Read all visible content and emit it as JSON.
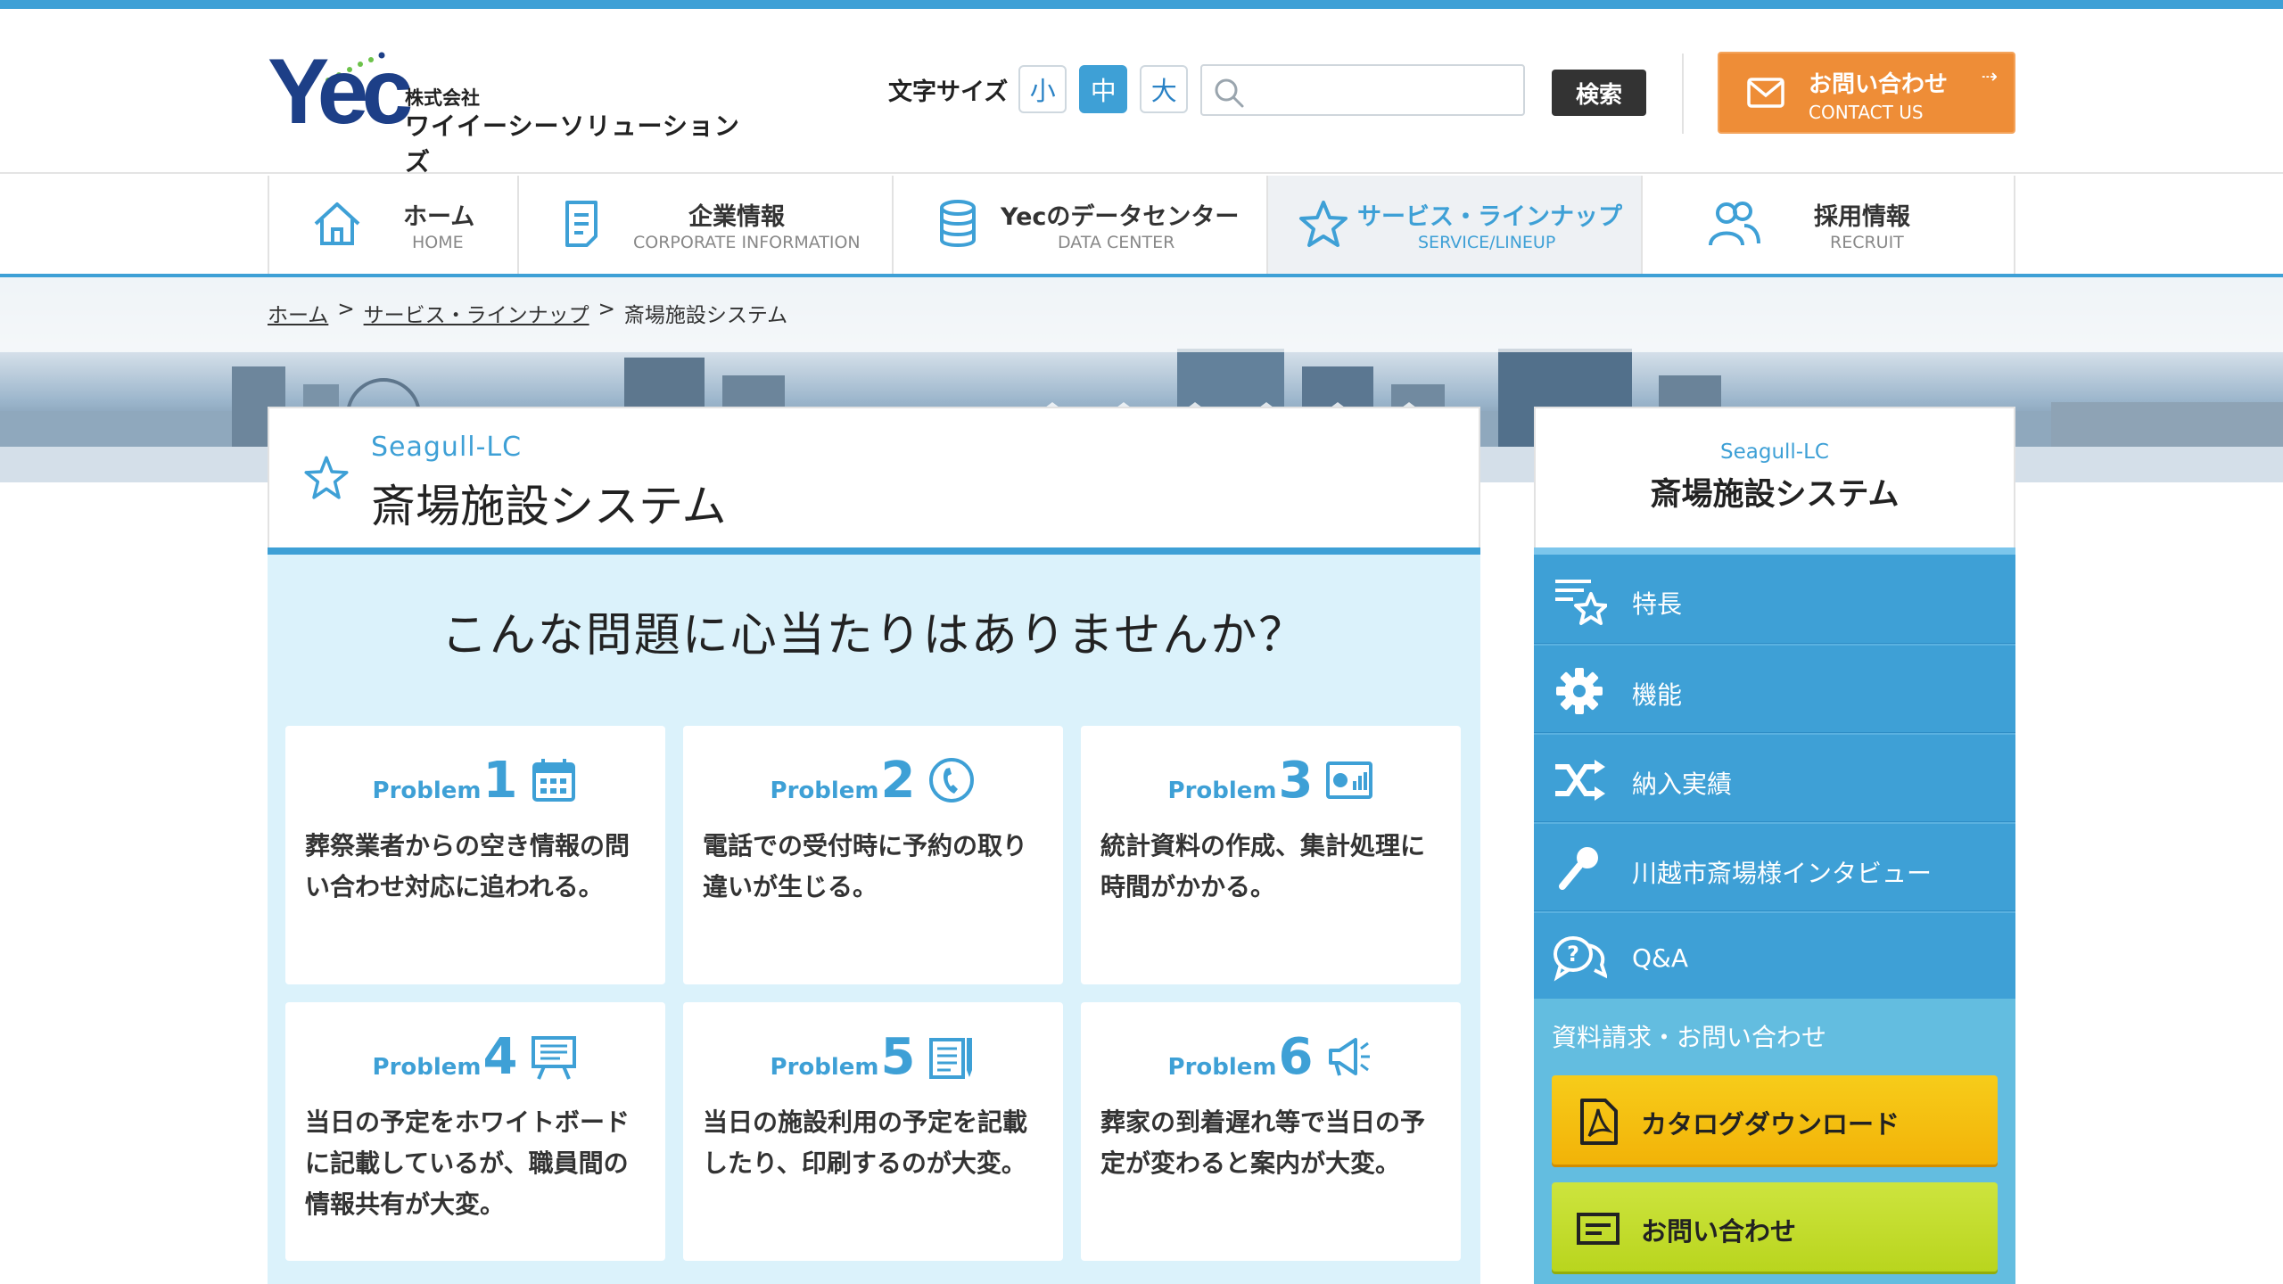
{
  "logo": {
    "mark": "Yec",
    "company_type": "株式会社",
    "company_name": "ワイイーシーソリューションズ"
  },
  "header": {
    "font_size_label": "文字サイズ",
    "font_sizes": [
      "小",
      "中",
      "大"
    ],
    "font_size_selected": "中",
    "search_placeholder": "",
    "search_button": "検索",
    "contact_jp": "お問い合わせ",
    "contact_en": "CONTACT US"
  },
  "nav": [
    {
      "jp": "ホーム",
      "en": "HOME",
      "icon": "home-icon"
    },
    {
      "jp": "企業情報",
      "en": "CORPORATE INFORMATION",
      "icon": "document-icon"
    },
    {
      "jp": "Yecのデータセンター",
      "en": "DATA CENTER",
      "icon": "database-icon"
    },
    {
      "jp": "サービス・ラインナップ",
      "en": "SERVICE/LINEUP",
      "icon": "star-icon",
      "active": true
    },
    {
      "jp": "採用情報",
      "en": "RECRUIT",
      "icon": "people-icon"
    }
  ],
  "breadcrumb": [
    "ホーム",
    "サービス・ラインナップ",
    "斎場施設システム"
  ],
  "breadcrumb_sep": ">",
  "main": {
    "subtitle": "Seagull-LC",
    "title": "斎場施設システム",
    "question": "こんな問題に心当たりはありませんか？",
    "problem_word": "Problem",
    "problems": [
      {
        "num": "1",
        "text": "葬祭業者からの空き情報の問い合わせ対応に追われる。",
        "icon": "calendar-icon"
      },
      {
        "num": "2",
        "text": "電話での受付時に予約の取り違いが生じる。",
        "icon": "phone-icon"
      },
      {
        "num": "3",
        "text": "統計資料の作成、集計処理に時間がかかる。",
        "icon": "chart-icon"
      },
      {
        "num": "4",
        "text": "当日の予定をホワイトボードに記載しているが、職員間の情報共有が大変。",
        "icon": "whiteboard-icon"
      },
      {
        "num": "5",
        "text": "当日の施設利用の予定を記載したり、印刷するのが大変。",
        "icon": "notepad-icon"
      },
      {
        "num": "6",
        "text": "葬家の到着遅れ等で当日の予定が変わると案内が大変。",
        "icon": "megaphone-icon"
      }
    ]
  },
  "sidebar": {
    "subtitle": "Seagull-LC",
    "title": "斎場施設システム",
    "items": [
      {
        "label": "特長",
        "icon": "list-star-icon"
      },
      {
        "label": "機能",
        "icon": "gear-icon"
      },
      {
        "label": "納入実績",
        "icon": "shuffle-icon"
      },
      {
        "label": "川越市斎場様インタビュー",
        "icon": "microphone-icon"
      },
      {
        "label": "Q&A",
        "icon": "question-bubble-icon"
      }
    ],
    "contact_title": "資料請求・お問い合わせ",
    "catalog_button": "カタログダウンロード",
    "inquiry_button": "お問い合わせ"
  },
  "colors": {
    "accent": "#3ea0d6",
    "contact": "#ee8d37",
    "panel_bg": "#dbf2fb",
    "catalog": "#f2b308",
    "inquiry": "#bed823"
  }
}
